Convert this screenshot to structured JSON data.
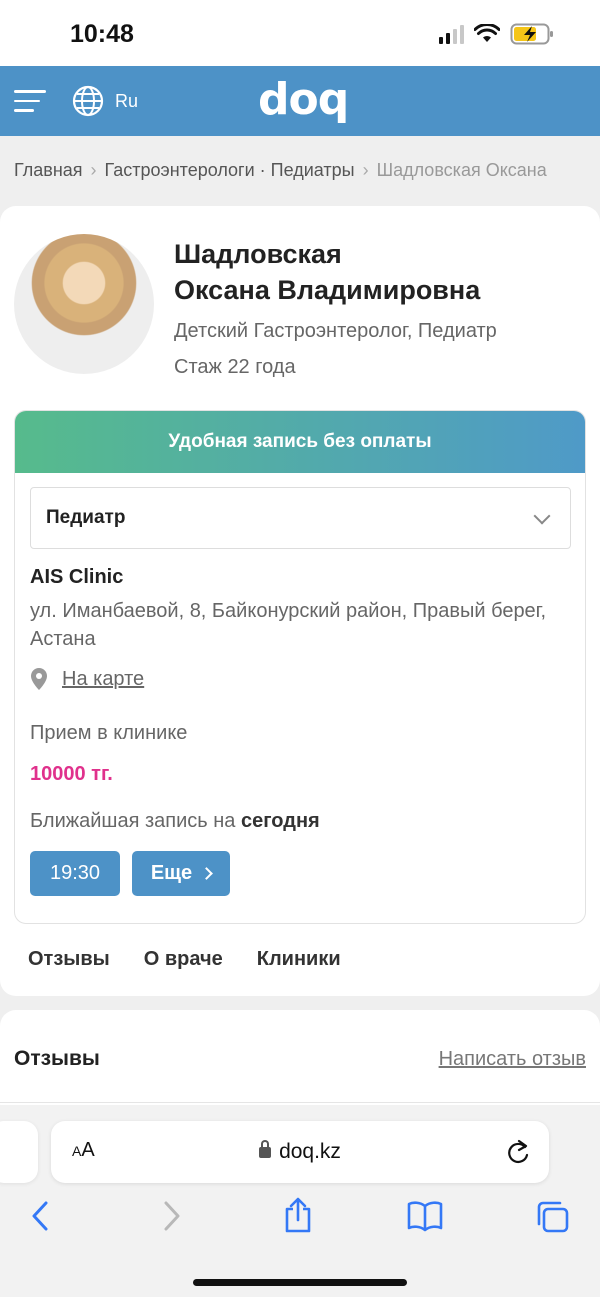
{
  "status_bar": {
    "time": "10:48"
  },
  "header": {
    "language": "Ru",
    "logo": "doq"
  },
  "breadcrumb": {
    "home": "Главная",
    "category": "Гастроэнтерологи · Педиатры",
    "current": "Шадловская Оксана"
  },
  "doctor": {
    "name_line1": "Шадловская",
    "name_line2": "Оксана Владимировна",
    "specialty": "Детский Гастроэнтеролог, Педиатр",
    "experience": "Стаж 22 года"
  },
  "booking": {
    "banner": "Удобная запись без оплаты",
    "selected_specialty": "Педиатр",
    "clinic_name": "AIS Clinic",
    "clinic_address": "ул. Иманбаевой, 8, Байконурский район, Правый берег, Астана",
    "map_link": "На карте",
    "visit_type": "Прием в клинике",
    "price": "10000 тг.",
    "nearest_prefix": "Ближайшая запись на",
    "nearest_day": "сегодня",
    "slot_time": "19:30",
    "more_label": "Еще"
  },
  "tabs": [
    "Отзывы",
    "О враче",
    "Клиники"
  ],
  "reviews": {
    "title": "Отзывы",
    "write_link": "Написать отзыв"
  },
  "browser": {
    "text_size_small": "A",
    "text_size_large": "A",
    "url": "doq.kz"
  },
  "colors": {
    "header": "#4d92c7",
    "price": "#e0318c",
    "banner_start": "#56bb8c",
    "banner_end": "#4f9ac8"
  },
  "icons": [
    "menu-icon",
    "globe-icon",
    "chevron-down-icon",
    "map-pin-icon",
    "chevron-right-icon",
    "lock-icon",
    "reload-icon",
    "back-icon",
    "forward-icon",
    "share-icon",
    "bookmarks-icon",
    "tabs-icon"
  ]
}
